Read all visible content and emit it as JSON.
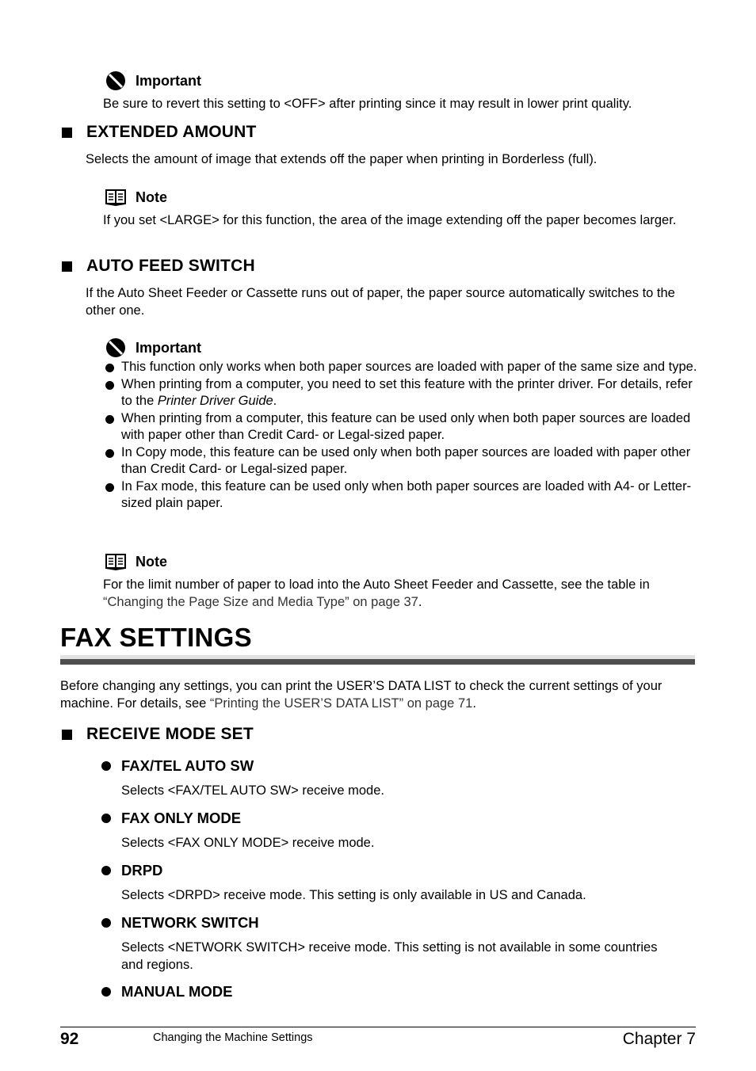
{
  "important_1": {
    "label": "Important",
    "text": "Be sure to revert this setting to <OFF> after printing since it may result in lower print quality."
  },
  "extended_amount": {
    "heading": "EXTENDED AMOUNT",
    "text": "Selects the amount of image that extends off the paper when printing in Borderless (full).",
    "note": {
      "label": "Note",
      "text": "If you set <LARGE> for this function, the area of the image extending off the paper becomes larger."
    }
  },
  "auto_feed_switch": {
    "heading": "AUTO FEED SWITCH",
    "text": "If the Auto Sheet Feeder or Cassette runs out of paper, the paper source automatically switches to the other one.",
    "important": {
      "label": "Important",
      "items": [
        {
          "text": "This function only works when both paper sources are loaded with paper of the same size and type."
        },
        {
          "text_before": "When printing from a computer, you need to set this feature with the printer driver. For details, refer to the ",
          "italic": "Printer Driver Guide",
          "text_after": "."
        },
        {
          "text": "When printing from a computer, this feature can be used only when both paper sources are loaded with paper other than Credit Card- or Legal-sized paper."
        },
        {
          "text": "In Copy mode, this feature can be used only when both paper sources are loaded with paper other than Credit Card- or Legal-sized paper."
        },
        {
          "text": "In Fax mode, this feature can be used only when both paper sources are loaded with A4- or Letter-sized plain paper."
        }
      ]
    },
    "note": {
      "label": "Note",
      "text_before": "For the limit number of paper to load into the Auto Sheet Feeder and Cassette, see the table in ",
      "link": "“Changing the Page Size and Media Type” on page 37",
      "text_after": "."
    }
  },
  "fax_settings": {
    "title": "FAX SETTINGS",
    "intro_before": "Before changing any settings, you can print the USER’S DATA LIST to check the current settings of your machine. For details, see ",
    "intro_link": "“Printing the USER’S DATA LIST” on page 71",
    "intro_after": ".",
    "receive_mode_set": {
      "heading": "RECEIVE MODE SET",
      "modes": [
        {
          "name": "FAX/TEL AUTO SW",
          "desc": "Selects <FAX/TEL AUTO SW> receive mode."
        },
        {
          "name": "FAX ONLY MODE",
          "desc": "Selects <FAX ONLY MODE> receive mode."
        },
        {
          "name": "DRPD",
          "desc": "Selects <DRPD> receive mode. This setting is only available in US and Canada."
        },
        {
          "name": "NETWORK SWITCH",
          "desc": "Selects <NETWORK SWITCH> receive mode. This setting is not available in some countries and regions."
        },
        {
          "name": "MANUAL MODE",
          "desc": ""
        }
      ]
    }
  },
  "footer": {
    "page_number": "92",
    "section": "Changing the Machine Settings",
    "chapter": "Chapter 7"
  }
}
